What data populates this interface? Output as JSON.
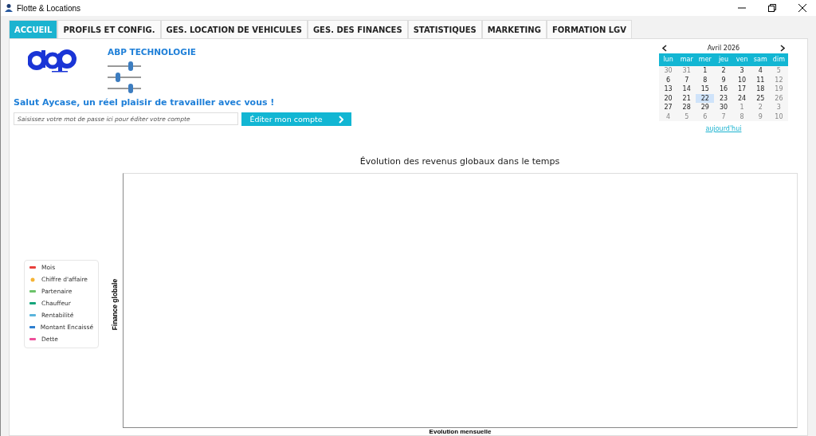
{
  "window": {
    "title": "Flotte & Locations"
  },
  "tabs": [
    {
      "label": "ACCUEIL",
      "selected": true
    },
    {
      "label": "PROFILS ET CONFIG.",
      "selected": false
    },
    {
      "label": "GES. LOCATION DE VEHICULES",
      "selected": false
    },
    {
      "label": "GES. DES FINANCES",
      "selected": false
    },
    {
      "label": "STATISTIQUES",
      "selected": false
    },
    {
      "label": "MARKETING",
      "selected": false
    },
    {
      "label": "FORMATION LGV",
      "selected": false
    }
  ],
  "company": {
    "name": "ABP TECHNOLOGIE"
  },
  "greeting": "Salut Aycase, un réel plaisir de travailler avec vous !",
  "password": {
    "placeholder": "Saisissez votre mot de passe ici pour éditer votre compte"
  },
  "edit_button": {
    "label": "Éditer mon compte"
  },
  "calendar": {
    "month": "Avril 2026",
    "weekdays": [
      "lun",
      "mar",
      "mer",
      "jeu",
      "ven",
      "sam",
      "dim"
    ],
    "days": [
      {
        "label": "30",
        "muted": true,
        "selected": false
      },
      {
        "label": "31",
        "muted": true,
        "selected": false
      },
      {
        "label": "1",
        "muted": false,
        "selected": false
      },
      {
        "label": "2",
        "muted": false,
        "selected": false
      },
      {
        "label": "3",
        "muted": false,
        "selected": false
      },
      {
        "label": "4",
        "muted": false,
        "selected": false
      },
      {
        "label": "5",
        "muted": true,
        "selected": false
      },
      {
        "label": "6",
        "muted": false,
        "selected": false
      },
      {
        "label": "7",
        "muted": false,
        "selected": false
      },
      {
        "label": "8",
        "muted": false,
        "selected": false
      },
      {
        "label": "9",
        "muted": false,
        "selected": false
      },
      {
        "label": "10",
        "muted": false,
        "selected": false
      },
      {
        "label": "11",
        "muted": false,
        "selected": false
      },
      {
        "label": "12",
        "muted": true,
        "selected": false
      },
      {
        "label": "13",
        "muted": false,
        "selected": false
      },
      {
        "label": "14",
        "muted": false,
        "selected": false
      },
      {
        "label": "15",
        "muted": false,
        "selected": false
      },
      {
        "label": "16",
        "muted": false,
        "selected": false
      },
      {
        "label": "17",
        "muted": false,
        "selected": false
      },
      {
        "label": "18",
        "muted": false,
        "selected": false
      },
      {
        "label": "19",
        "muted": true,
        "selected": false
      },
      {
        "label": "20",
        "muted": false,
        "selected": false
      },
      {
        "label": "21",
        "muted": false,
        "selected": false
      },
      {
        "label": "22",
        "muted": false,
        "selected": true
      },
      {
        "label": "23",
        "muted": false,
        "selected": false
      },
      {
        "label": "24",
        "muted": false,
        "selected": false
      },
      {
        "label": "25",
        "muted": false,
        "selected": false
      },
      {
        "label": "26",
        "muted": true,
        "selected": false
      },
      {
        "label": "27",
        "muted": false,
        "selected": false
      },
      {
        "label": "28",
        "muted": false,
        "selected": false
      },
      {
        "label": "29",
        "muted": false,
        "selected": false
      },
      {
        "label": "30",
        "muted": false,
        "selected": false
      },
      {
        "label": "1",
        "muted": true,
        "selected": false
      },
      {
        "label": "2",
        "muted": true,
        "selected": false
      },
      {
        "label": "3",
        "muted": true,
        "selected": false
      },
      {
        "label": "4",
        "muted": true,
        "selected": false
      },
      {
        "label": "5",
        "muted": true,
        "selected": false
      },
      {
        "label": "6",
        "muted": true,
        "selected": false
      },
      {
        "label": "7",
        "muted": true,
        "selected": false
      },
      {
        "label": "8",
        "muted": true,
        "selected": false
      },
      {
        "label": "9",
        "muted": true,
        "selected": false
      },
      {
        "label": "10",
        "muted": true,
        "selected": false
      }
    ],
    "today_link": "aujourd'hui"
  },
  "chart": {
    "title": "Évolution des revenus globaux dans le temps",
    "ylabel": "Finance globale",
    "xlabel": "Evolution mensuelle",
    "legend": [
      {
        "label": "Mois",
        "color": "#e8413c",
        "kind": "line"
      },
      {
        "label": "Chiffre d'affaire",
        "color": "#f5b335",
        "kind": "marker"
      },
      {
        "label": "Partenaire",
        "color": "#6cc26a",
        "kind": "line"
      },
      {
        "label": "Chauffeur",
        "color": "#15a57b",
        "kind": "line"
      },
      {
        "label": "Rentabilité",
        "color": "#5ab4dc",
        "kind": "line"
      },
      {
        "label": "Montant Encaissé",
        "color": "#2e7fcf",
        "kind": "line"
      },
      {
        "label": "Dette",
        "color": "#ee4f9a",
        "kind": "line"
      }
    ]
  }
}
